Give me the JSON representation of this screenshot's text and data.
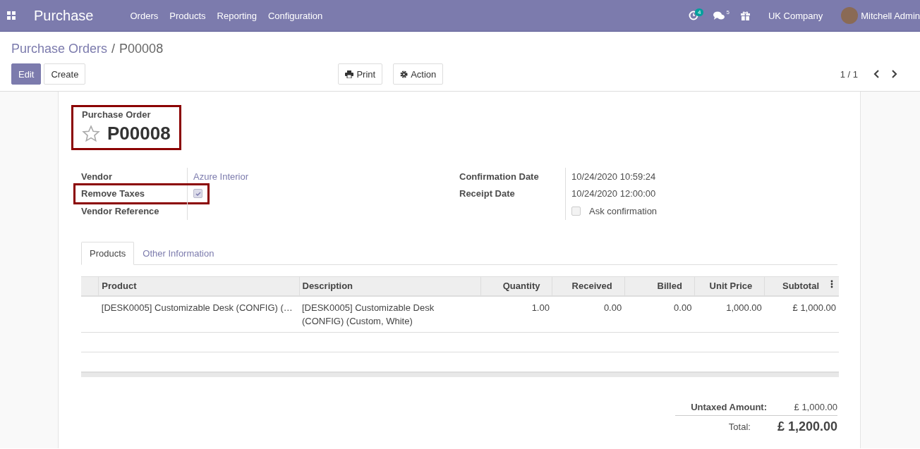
{
  "navbar": {
    "app_name": "Purchase",
    "menu": [
      "Orders",
      "Products",
      "Reporting",
      "Configuration"
    ],
    "activity_count": "4",
    "message_count": "5",
    "company": "UK Company",
    "user": "Mitchell Admin"
  },
  "breadcrumb": {
    "parent": "Purchase Orders",
    "separator": "/",
    "current": "P00008"
  },
  "buttons": {
    "edit": "Edit",
    "create": "Create",
    "print": "Print",
    "action": "Action"
  },
  "pager": "1 / 1",
  "form": {
    "subtitle": "Purchase Order",
    "name": "P00008",
    "starred": false,
    "left_fields": [
      {
        "label": "Vendor",
        "kind": "link",
        "value": "Azure Interior",
        "highlighted": false
      },
      {
        "label": "Remove Taxes",
        "kind": "checkbox",
        "checked": true,
        "highlighted": true
      },
      {
        "label": "Vendor Reference",
        "kind": "text",
        "highlighted": false
      }
    ],
    "right_fields": [
      {
        "label": "Confirmation Date",
        "kind": "text",
        "value": "10/24/2020 10:59:24"
      },
      {
        "label": "Receipt Date",
        "kind": "text",
        "value": "10/24/2020 12:00:00"
      },
      {
        "kind": "checkbox",
        "checked": false,
        "text": "Ask confirmation"
      }
    ]
  },
  "tabs": [
    {
      "label": "Products",
      "selected": true
    },
    {
      "label": "Other Information",
      "selected": false
    }
  ],
  "table": {
    "columns": [
      "Product",
      "Description",
      "Quantity",
      "Received",
      "Billed",
      "Unit Price",
      "Subtotal"
    ],
    "rows": [
      [
        "[DESK0005] Customizable Desk (CONFIG) (…",
        "[DESK0005] Customizable Desk (CONFIG) (Custom, White)",
        "1.00",
        "0.00",
        "0.00",
        "1,000.00",
        "£ 1,000.00"
      ]
    ]
  },
  "totals": {
    "untaxed_label": "Untaxed Amount:",
    "untaxed": "£ 1,000.00",
    "total_label": "Total:",
    "total": "£ 1,200.00"
  }
}
